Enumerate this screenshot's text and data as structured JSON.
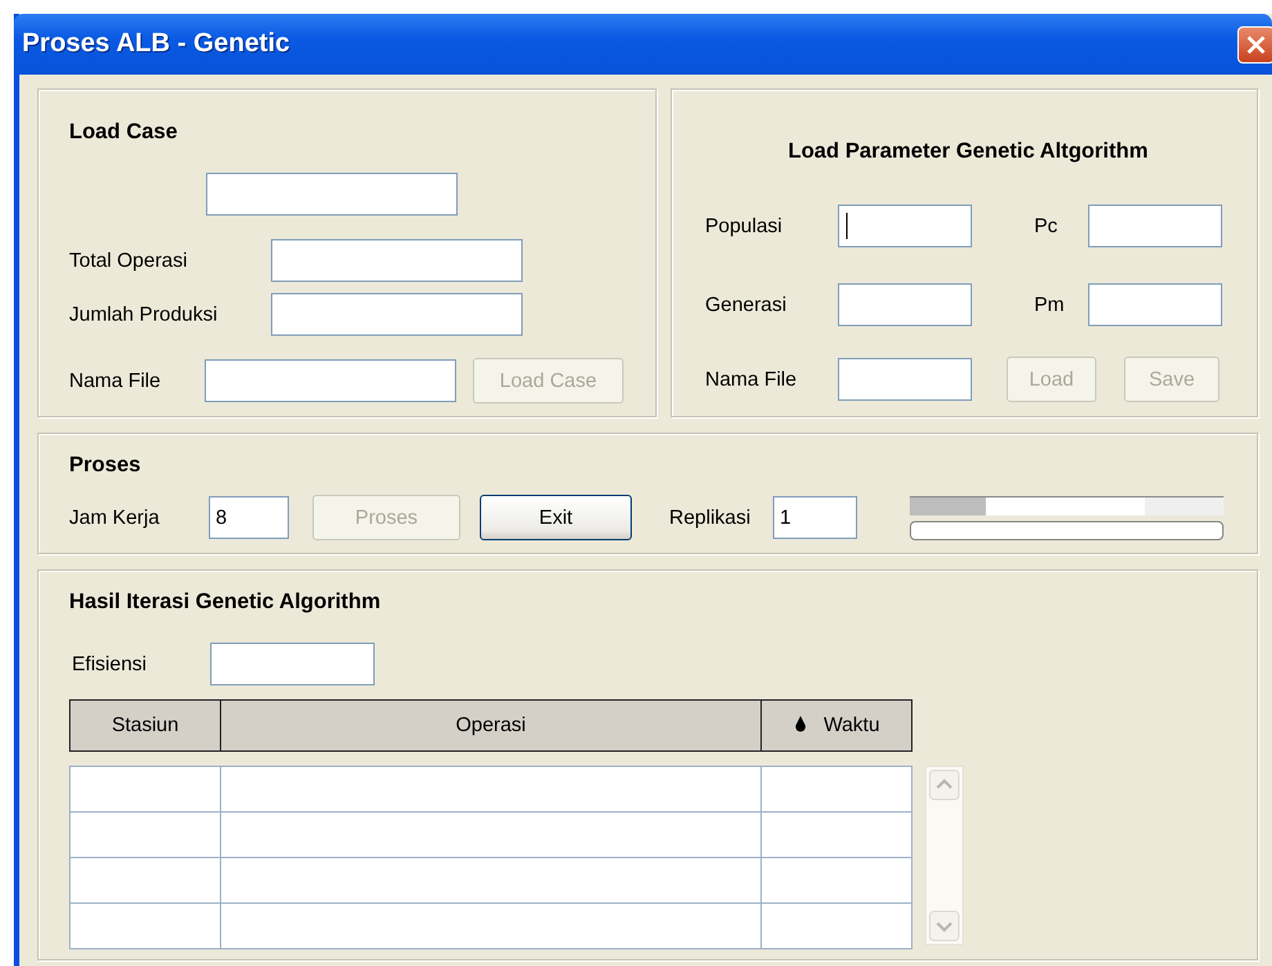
{
  "window": {
    "title": "Proses ALB - Genetic"
  },
  "load_case": {
    "title": "Load Case",
    "fields": [
      {
        "label": "Total Operasi"
      },
      {
        "label": "Jumlah Produksi"
      }
    ],
    "file": {
      "label": "Nama File"
    },
    "button": {
      "label": "Load Case",
      "disabled": true
    }
  },
  "parameters": {
    "title": "Load Parameter Genetic Altgorithm",
    "fields": [
      {
        "label": "Populasi",
        "focused": true
      },
      {
        "label": "Pc",
        "focused": false
      },
      {
        "label": "Generasi",
        "focused": false
      },
      {
        "label": "Pm",
        "focused": false
      }
    ],
    "file": {
      "label": "Nama File"
    },
    "buttons": [
      {
        "label": "Load",
        "disabled": true
      },
      {
        "label": "Save",
        "disabled": true
      }
    ]
  },
  "proses": {
    "title": "Proses",
    "jam_kerja": {
      "label": "Jam Kerja",
      "value": "8"
    },
    "buttons": [
      {
        "label": "Proses",
        "disabled": true
      },
      {
        "label": "Exit",
        "disabled": false
      }
    ],
    "replikasi": {
      "label": "Replikasi",
      "value": "1"
    },
    "progress": {
      "level": 0
    }
  },
  "hasil": {
    "title": "Hasil Iterasi Genetic Algorithm",
    "efisiensi": {
      "label": "Efisiensi"
    },
    "table": {
      "columns": [
        {
          "label": "Stasiun",
          "sorted": false
        },
        {
          "label": "Operasi",
          "sorted": false
        },
        {
          "label": "Waktu",
          "sorted": true
        }
      ]
    }
  }
}
